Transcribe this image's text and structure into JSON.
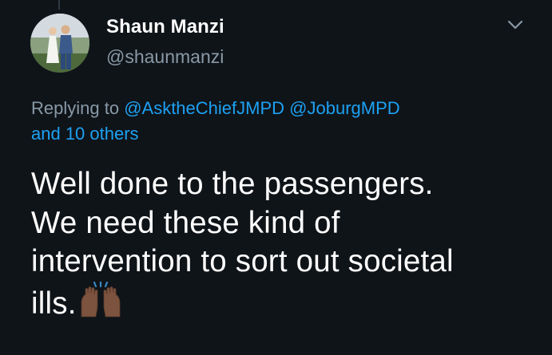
{
  "author": {
    "name": "Shaun Manzi",
    "handle": "@shaunmanzi"
  },
  "reply": {
    "prefix": "Replying to ",
    "mention_1": "@AsktheChiefJMPD",
    "mention_2": "@JoburgMPD",
    "others": "and 10 others"
  },
  "tweet": {
    "lines": [
      "Well done to the passengers.",
      "We need these kind of",
      "intervention to sort out societal",
      "ills."
    ],
    "emoji": "raising-hands-dark-skin-tone-icon"
  },
  "colors": {
    "background": "#0f1419",
    "text_primary": "#ffffff",
    "text_secondary": "#8899a6",
    "link": "#1da1f2"
  },
  "icons": {
    "menu": "chevron-down-icon"
  }
}
